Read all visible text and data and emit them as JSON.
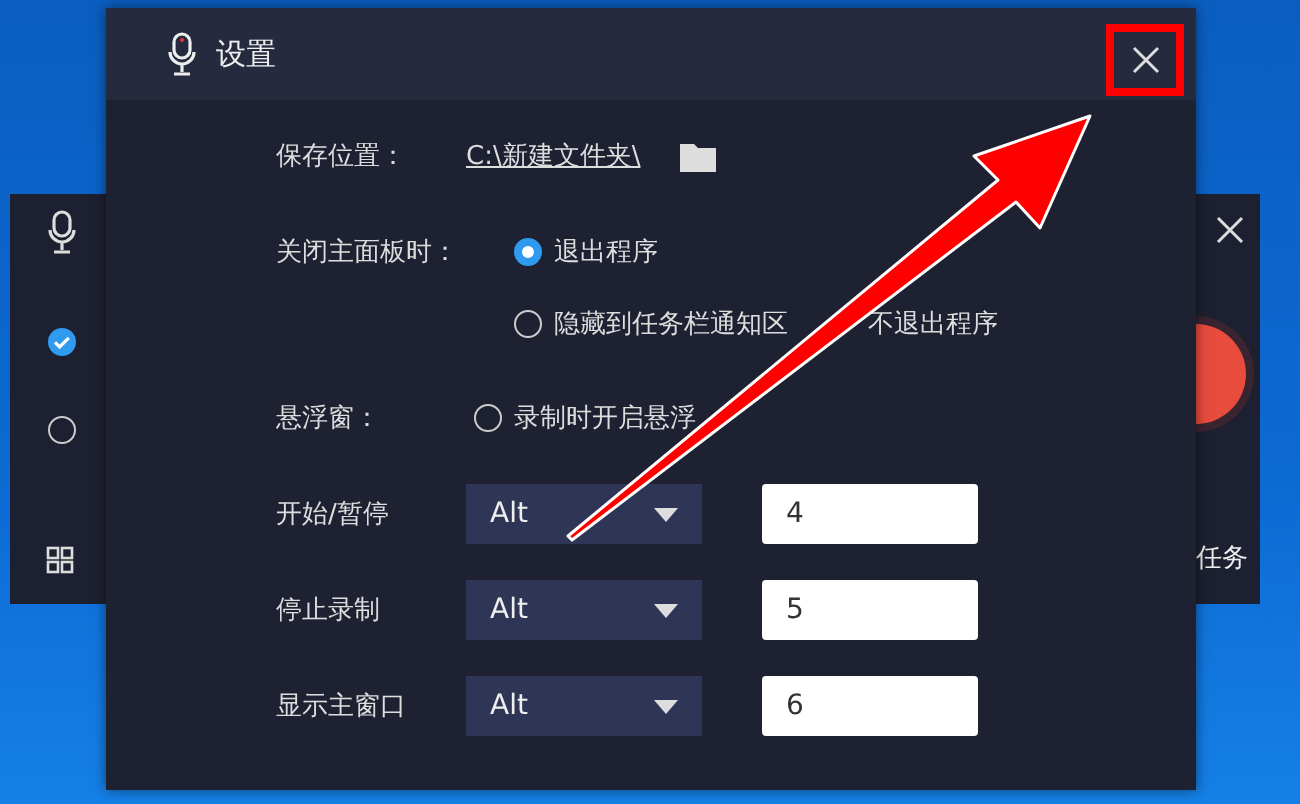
{
  "background_window": {
    "options": [
      {
        "selected": true
      },
      {
        "selected": false
      }
    ],
    "task_label": "任务"
  },
  "dialog": {
    "title": "设置",
    "save_location": {
      "label": "保存位置：",
      "path": "C:\\新建文件夹\\"
    },
    "close_panel": {
      "label": "关闭主面板时：",
      "options": [
        {
          "label": "退出程序",
          "selected": true
        },
        {
          "label": "隐藏到任务栏通知区",
          "label_continued": "不退出程序",
          "selected": false
        }
      ]
    },
    "floating_window": {
      "label": "悬浮窗：",
      "option": {
        "label": "录制时开启悬浮",
        "checked": false
      }
    },
    "hotkeys": [
      {
        "label": "开始/暂停",
        "modifier": "Alt",
        "key": "4"
      },
      {
        "label": "停止录制",
        "modifier": "Alt",
        "key": "5"
      },
      {
        "label": "显示主窗口",
        "modifier": "Alt",
        "key": "6"
      }
    ]
  },
  "annotation": {
    "close_highlighted": true,
    "arrow": true
  }
}
